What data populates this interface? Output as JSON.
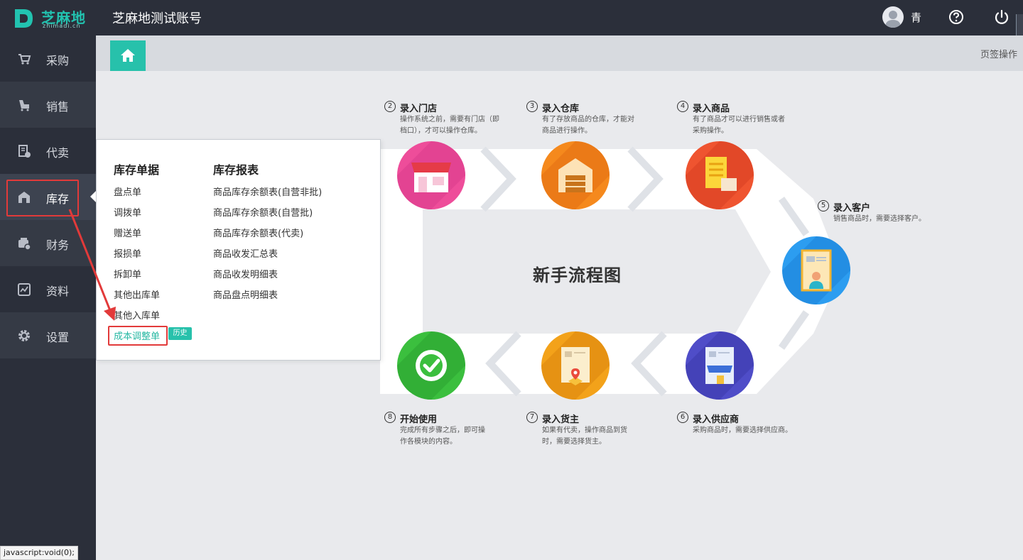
{
  "topbar": {
    "logo_text": "芝麻地",
    "logo_sub": "zhimadi.cn",
    "account_name": "芝麻地测试账号",
    "username": "青"
  },
  "sidebar": {
    "items": [
      {
        "label": "采购",
        "icon": "cart-icon"
      },
      {
        "label": "销售",
        "icon": "sales-icon"
      },
      {
        "label": "代卖",
        "icon": "consign-icon"
      },
      {
        "label": "库存",
        "icon": "warehouse-icon",
        "active": true
      },
      {
        "label": "财务",
        "icon": "finance-icon"
      },
      {
        "label": "资料",
        "icon": "data-icon"
      },
      {
        "label": "设置",
        "icon": "gear-icon"
      }
    ]
  },
  "tabs": {
    "home_icon": "home-icon",
    "ops_label": "页签操作"
  },
  "flow": {
    "title": "新手流程图",
    "steps": [
      {
        "num": "2",
        "title": "录入门店",
        "desc": [
          "操作系统之前，需要有门店（即",
          "档口），才可以操作仓库。"
        ]
      },
      {
        "num": "3",
        "title": "录入仓库",
        "desc": [
          "有了存放商品的仓库，才能对",
          "商品进行操作。"
        ]
      },
      {
        "num": "4",
        "title": "录入商品",
        "desc": [
          "有了商品才可以进行销售或者",
          "采购操作。"
        ]
      },
      {
        "num": "5",
        "title": "录入客户",
        "desc": [
          "销售商品时，需要选择客户。"
        ]
      },
      {
        "num": "6",
        "title": "录入供应商",
        "desc": [
          "采购商品时，需要选择供应商。"
        ]
      },
      {
        "num": "7",
        "title": "录入货主",
        "desc": [
          "如果有代卖，操作商品到货",
          "时，需要选择货主。"
        ]
      },
      {
        "num": "8",
        "title": "开始使用",
        "desc": [
          "完成所有步骤之后，即可操",
          "作各模块的内容。"
        ]
      }
    ],
    "colors": {
      "store": "#ee4d9a",
      "warehouse": "#f5891d",
      "goods": "#ef5430",
      "customer": "#2c9df0",
      "supplier": "#4f4dc8",
      "owner": "#f3a21a",
      "start": "#3bbf3e"
    }
  },
  "dropdown": {
    "col1_title": "库存单据",
    "col1_items": [
      "盘点单",
      "调拨单",
      "赠送单",
      "报损单",
      "拆卸单",
      "其他出库单",
      "其他入库单",
      "成本调整单"
    ],
    "col2_title": "库存报表",
    "col2_items": [
      "商品库存余额表(自营非批)",
      "商品库存余额表(自营批)",
      "商品库存余额表(代卖)",
      "商品收发汇总表",
      "商品收发明细表",
      "商品盘点明细表"
    ],
    "history_badge": "历史"
  },
  "status_bar": "javascript:void(0);"
}
